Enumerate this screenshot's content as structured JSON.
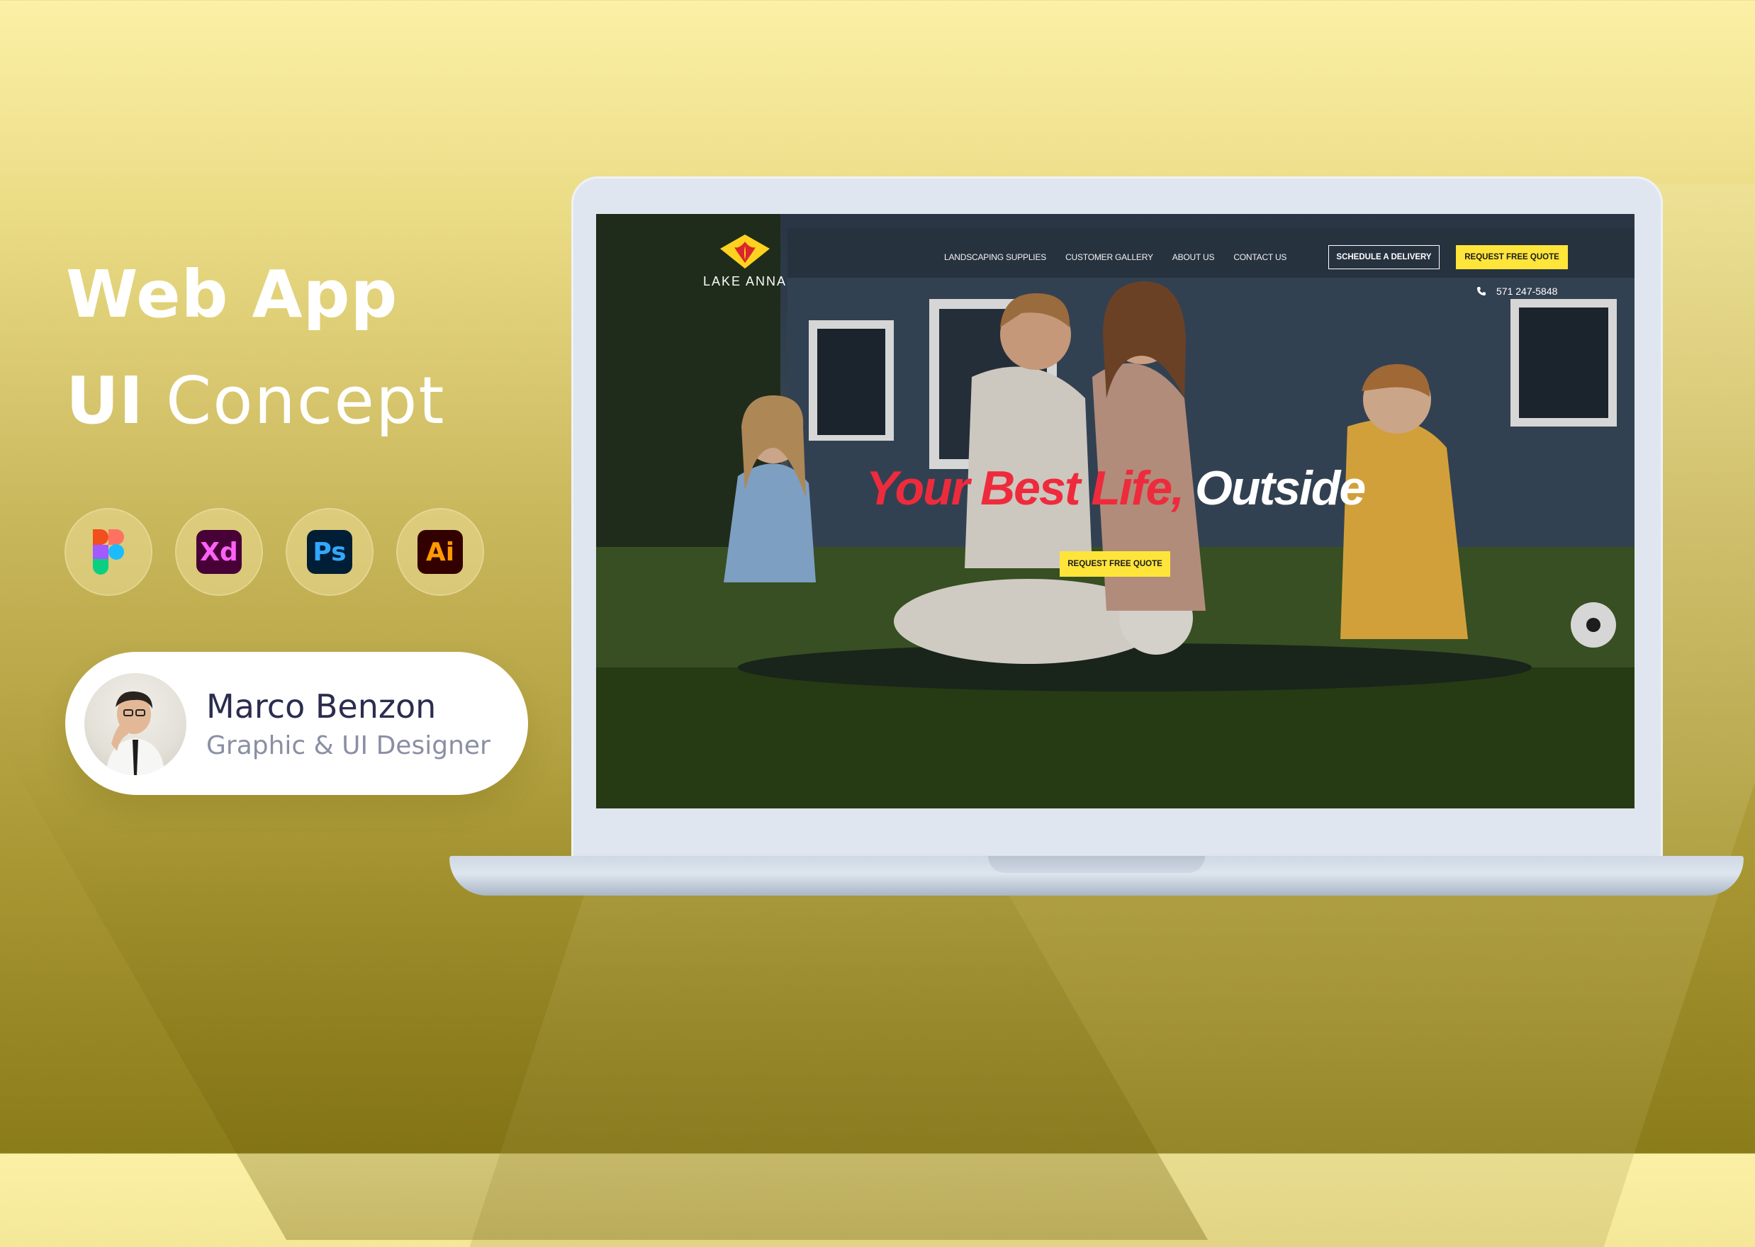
{
  "showcase": {
    "title_line1": "Web App",
    "title_line2_bold": "UI",
    "title_line2_light": "Concept",
    "tools": [
      "figma-icon",
      "adobe-xd-icon",
      "photoshop-icon",
      "illustrator-icon"
    ],
    "xd_label": "Xd",
    "ps_label": "Ps",
    "ai_label": "Ai",
    "designer_name": "Marco Benzon",
    "designer_role": "Graphic & UI Designer"
  },
  "site": {
    "brand": "LAKE ANNA",
    "nav": [
      "LANDSCAPING SUPPLIES",
      "CUSTOMER GALLERY",
      "ABOUT US",
      "CONTACT US"
    ],
    "schedule_button": "SCHEDULE A DELIVERY",
    "quote_button": "REQUEST FREE QUOTE",
    "phone": "571 247-5848",
    "hero_title_red": "Your Best Life,",
    "hero_title_white": " Outside",
    "hero_cta": "REQUEST FREE QUOTE"
  },
  "colors": {
    "accent_yellow": "#ffe53a",
    "hero_red": "#ee2b3c",
    "name_navy": "#2b2d4f"
  }
}
